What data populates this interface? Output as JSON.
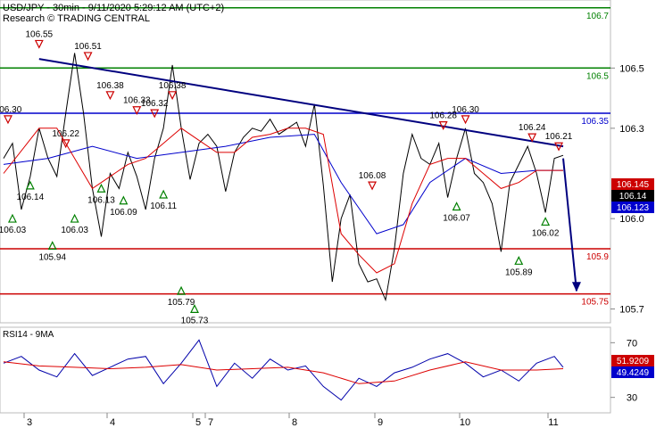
{
  "header": {
    "title": "USD/JPY - 30min - 9/11/2020 5:29:12 AM (UTC+2)",
    "source": "Research © TRADING CENTRAL"
  },
  "chart_data": [
    {
      "type": "line",
      "title": "USD/JPY - 30min - 9/11/2020 5:29:12 AM (UTC+2)",
      "ylim": [
        105.66,
        106.72
      ],
      "x_tick_labels": [
        "3",
        "4",
        "5",
        "7",
        "8",
        "9",
        "10",
        "11"
      ],
      "y_tick_labels": [
        "106.5",
        "106.3",
        "106.0",
        "105.7"
      ],
      "y_ticks": [
        106.5,
        106.3,
        106.0,
        105.7
      ],
      "price_series": {
        "name": "USD/JPY",
        "x": [
          0,
          2,
          4,
          6,
          8,
          10,
          12,
          14,
          16,
          18,
          20,
          22,
          24,
          26,
          28,
          30,
          32,
          34,
          36,
          38,
          40,
          42,
          44,
          46,
          48,
          50,
          52,
          54,
          56,
          58,
          60,
          62,
          64,
          66,
          68,
          70,
          72,
          74,
          76,
          78,
          80,
          82,
          84,
          86,
          88,
          90,
          92,
          94,
          96,
          98,
          100,
          102,
          104,
          106,
          108,
          110,
          112,
          114,
          116,
          118,
          120,
          122,
          124,
          126
        ],
        "y": [
          106.2,
          106.25,
          106.03,
          106.14,
          106.3,
          106.2,
          106.14,
          106.35,
          106.55,
          106.35,
          106.1,
          105.94,
          106.15,
          106.1,
          106.22,
          106.14,
          106.03,
          106.2,
          106.3,
          106.51,
          106.3,
          106.13,
          106.25,
          106.28,
          106.24,
          106.09,
          106.22,
          106.27,
          106.3,
          106.29,
          106.33,
          106.28,
          106.3,
          106.32,
          106.24,
          106.38,
          106.11,
          105.79,
          106.0,
          106.08,
          105.85,
          105.79,
          105.8,
          105.73,
          105.9,
          106.15,
          106.28,
          106.2,
          106.18,
          106.25,
          106.07,
          106.2,
          106.3,
          106.15,
          106.12,
          106.05,
          105.89,
          106.12,
          106.18,
          106.24,
          106.15,
          106.02,
          106.2,
          106.21
        ]
      },
      "moving_average_fast": {
        "x": [
          0,
          8,
          12,
          16,
          20,
          24,
          28,
          32,
          36,
          40,
          44,
          48,
          52,
          56,
          60,
          64,
          68,
          72,
          76,
          80,
          84,
          88,
          92,
          96,
          100,
          104,
          108,
          112,
          116,
          120,
          126
        ],
        "y": [
          106.15,
          106.3,
          106.3,
          106.2,
          106.1,
          106.14,
          106.18,
          106.2,
          106.25,
          106.3,
          106.26,
          106.22,
          106.22,
          106.27,
          106.28,
          106.3,
          106.3,
          106.28,
          105.95,
          105.88,
          105.82,
          105.85,
          106.05,
          106.18,
          106.2,
          106.2,
          106.15,
          106.1,
          106.12,
          106.16,
          106.16
        ]
      },
      "moving_average_slow": {
        "x": [
          0,
          10,
          20,
          30,
          40,
          50,
          60,
          70,
          76,
          84,
          90,
          96,
          104,
          112,
          120,
          126
        ],
        "y": [
          106.18,
          106.2,
          106.24,
          106.2,
          106.22,
          106.24,
          106.27,
          106.28,
          106.12,
          105.95,
          105.98,
          106.12,
          106.2,
          106.15,
          106.16,
          106.16
        ]
      },
      "levels": [
        {
          "label": "106.7",
          "value": 106.7,
          "color": "#008000"
        },
        {
          "label": "106.5",
          "value": 106.5,
          "color": "#008000"
        },
        {
          "label": "106.35",
          "value": 106.35,
          "color": "#0000cc"
        },
        {
          "label": "105.9",
          "value": 105.9,
          "color": "#cc0000"
        },
        {
          "label": "105.75",
          "value": 105.75,
          "color": "#cc0000"
        }
      ],
      "trendline": {
        "x": [
          8,
          126
        ],
        "y": [
          106.53,
          106.24
        ],
        "color": "#00007f"
      },
      "forecast_arrow": {
        "x": [
          126,
          129
        ],
        "y": [
          106.2,
          105.76
        ],
        "color": "#00007f"
      },
      "swing_highs": [
        {
          "x": 1,
          "y": 106.3,
          "label": "106.30"
        },
        {
          "x": 8,
          "y": 106.55,
          "label": "106.55"
        },
        {
          "x": 19,
          "y": 106.51,
          "label": "106.51"
        },
        {
          "x": 24,
          "y": 106.38,
          "label": "106.38"
        },
        {
          "x": 30,
          "y": 106.33,
          "label": "106.33"
        },
        {
          "x": 34,
          "y": 106.32,
          "label": "106.32"
        },
        {
          "x": 38,
          "y": 106.38,
          "label": "106.38"
        },
        {
          "x": 99,
          "y": 106.28,
          "label": "106.28"
        },
        {
          "x": 104,
          "y": 106.3,
          "label": "106.30"
        },
        {
          "x": 119,
          "y": 106.24,
          "label": "106.24"
        },
        {
          "x": 125,
          "y": 106.21,
          "label": "106.21"
        },
        {
          "x": 83,
          "y": 106.08,
          "label": "106.08"
        },
        {
          "x": 14,
          "y": 106.22,
          "label": "106.22"
        }
      ],
      "swing_lows": [
        {
          "x": 2,
          "y": 106.03,
          "label": "106.03"
        },
        {
          "x": 6,
          "y": 106.14,
          "label": "106.14"
        },
        {
          "x": 11,
          "y": 105.94,
          "label": "105.94"
        },
        {
          "x": 16,
          "y": 106.03,
          "label": "106.03"
        },
        {
          "x": 22,
          "y": 106.13,
          "label": "106.13"
        },
        {
          "x": 27,
          "y": 106.09,
          "label": "106.09"
        },
        {
          "x": 36,
          "y": 106.11,
          "label": "106.11"
        },
        {
          "x": 40,
          "y": 105.79,
          "label": "105.79"
        },
        {
          "x": 43,
          "y": 105.73,
          "label": "105.73"
        },
        {
          "x": 102,
          "y": 106.07,
          "label": "106.07"
        },
        {
          "x": 116,
          "y": 105.89,
          "label": "105.89"
        },
        {
          "x": 122,
          "y": 106.02,
          "label": "106.02"
        }
      ],
      "price_tags": [
        {
          "value": 106.145,
          "label": "106.145",
          "color": "#cc0000"
        },
        {
          "value": 106.14,
          "label": "106.14",
          "color": "#000000"
        },
        {
          "value": 106.123,
          "label": "106.123",
          "color": "#0000cc"
        }
      ]
    },
    {
      "type": "line",
      "title": "RSI14 - 9MA",
      "ylim": [
        20,
        80
      ],
      "y_tick_labels": [
        "70",
        "30"
      ],
      "y_ticks": [
        70,
        30
      ],
      "rsi": {
        "x": [
          0,
          4,
          8,
          12,
          16,
          20,
          24,
          28,
          32,
          36,
          40,
          44,
          48,
          52,
          56,
          60,
          64,
          68,
          72,
          76,
          80,
          84,
          88,
          92,
          96,
          100,
          104,
          108,
          112,
          116,
          120,
          124,
          126
        ],
        "y": [
          55,
          60,
          50,
          45,
          62,
          46,
          52,
          58,
          60,
          40,
          55,
          72,
          38,
          55,
          44,
          58,
          50,
          53,
          38,
          28,
          44,
          38,
          48,
          52,
          58,
          62,
          55,
          45,
          50,
          42,
          55,
          60,
          52
        ]
      },
      "ma": {
        "x": [
          0,
          8,
          16,
          24,
          32,
          40,
          48,
          56,
          64,
          72,
          80,
          88,
          96,
          104,
          112,
          120,
          126
        ],
        "y": [
          56,
          53,
          52,
          51,
          52,
          54,
          50,
          51,
          52,
          48,
          40,
          42,
          50,
          56,
          50,
          50,
          51
        ]
      },
      "value_tags": [
        {
          "value": 51.9209,
          "label": "51.9209",
          "color": "#cc0000"
        },
        {
          "value": 49.4249,
          "label": "49.4249",
          "color": "#0000cc"
        }
      ]
    }
  ]
}
